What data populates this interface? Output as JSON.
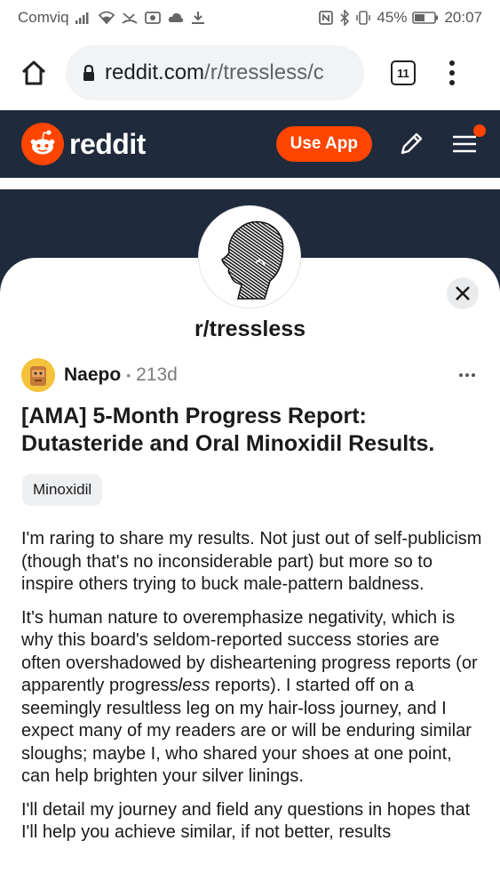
{
  "status_bar": {
    "carrier": "Comviq",
    "battery_percent": "45%",
    "time": "20:07",
    "icons": [
      "signal-icon",
      "wifi-icon",
      "missed-call-icon",
      "camera-icon",
      "cloud-icon",
      "download-icon",
      "nfc-icon",
      "bluetooth-icon",
      "vibrate-icon",
      "battery-icon"
    ]
  },
  "browser": {
    "url_host": "reddit.com",
    "url_path": "/r/tressless/c",
    "tab_count": "11"
  },
  "reddit_header": {
    "logo_text": "reddit",
    "use_app_label": "Use App",
    "brand_color": "#ff4500",
    "header_bg": "#1f2a3c"
  },
  "subreddit": {
    "name": "r/tressless"
  },
  "post": {
    "author": "Naepo",
    "separator": "•",
    "age": "213d",
    "title": "[AMA] 5-Month Progress Report: Dutasteride and Oral Minoxidil Results.",
    "flair": "Minoxidil",
    "paragraphs": {
      "p1": "I'm raring to share my results. Not just out of self-publicism (though that's no inconsiderable part) but more so to inspire others trying to buck male-pattern baldness.",
      "p2_before": "It's human nature to overemphasize negativity, which is why this board's seldom-reported success stories are often overshadowed by disheartening progress reports (or apparently progress",
      "p2_emph": "less",
      "p2_after": " reports). I started off on a seemingly resultless leg on my hair-loss journey, and I expect many of my readers are or will be enduring similar sloughs; maybe I, who shared your shoes at one point, can help brighten your silver linings.",
      "p3": "I'll detail my journey and field any questions in hopes that I'll help you achieve similar, if not better, results"
    }
  }
}
